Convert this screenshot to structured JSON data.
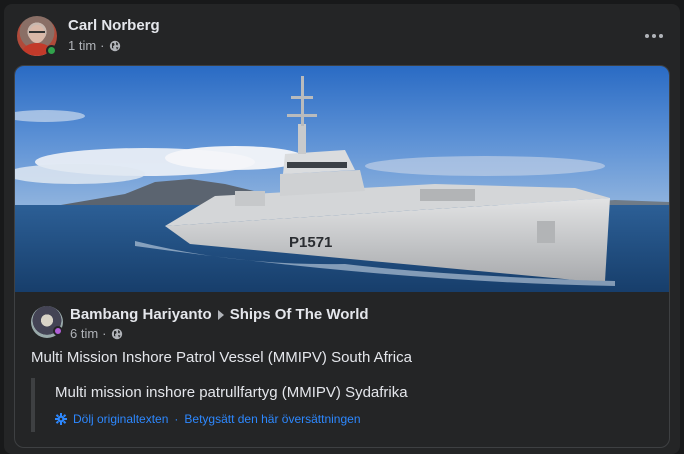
{
  "post": {
    "author": "Carl Norberg",
    "time": "1 tim",
    "privacy_icon": "globe-icon",
    "menu_icon": "more-horizontal-icon"
  },
  "shared": {
    "author": "Bambang Hariyanto",
    "group": "Ships Of The World",
    "time": "6 tim",
    "privacy_icon": "globe-icon",
    "text": "Multi Mission Inshore Patrol Vessel (MMIPV) South Africa",
    "image_hull_number": "P1571",
    "translation": {
      "text": "Multi mission inshore patrullfartyg (MMIPV) Sydafrika",
      "hide_original": "Dölj originaltexten",
      "separator": "·",
      "rate": "Betygsätt den här översättningen"
    }
  },
  "colors": {
    "background": "#18191a",
    "card": "#242526",
    "text": "#e4e6eb",
    "secondary_text": "#b0b3b8",
    "link": "#2d88ff",
    "online": "#31a24c"
  }
}
